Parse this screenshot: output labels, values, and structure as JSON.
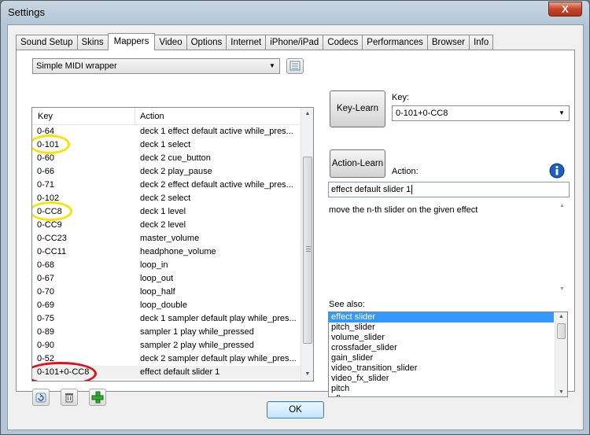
{
  "window": {
    "title": "Settings",
    "close_label": "X"
  },
  "tabs": [
    {
      "label": "Sound Setup"
    },
    {
      "label": "Skins"
    },
    {
      "label": "Mappers",
      "active": true
    },
    {
      "label": "Video"
    },
    {
      "label": "Options"
    },
    {
      "label": "Internet"
    },
    {
      "label": "iPhone/iPad"
    },
    {
      "label": "Codecs"
    },
    {
      "label": "Performances"
    },
    {
      "label": "Browser"
    },
    {
      "label": "Info"
    }
  ],
  "mapper": {
    "selected": "Simple MIDI wrapper"
  },
  "table": {
    "columns": [
      "Key",
      "Action"
    ],
    "rows": [
      {
        "key": "0-64",
        "action": "deck 1 effect  default active while_pres..."
      },
      {
        "key": "0-101",
        "action": "deck 1 select"
      },
      {
        "key": "0-60",
        "action": "deck 2 cue_button"
      },
      {
        "key": "0-66",
        "action": "deck 2 play_pause"
      },
      {
        "key": "0-71",
        "action": "deck 2 effect  default active while_pres..."
      },
      {
        "key": "0-102",
        "action": "deck 2 select"
      },
      {
        "key": "0-CC8",
        "action": "deck 1 level"
      },
      {
        "key": "0-CC9",
        "action": "deck 2 level"
      },
      {
        "key": "0-CC23",
        "action": "master_volume"
      },
      {
        "key": "0-CC11",
        "action": "headphone_volume"
      },
      {
        "key": "0-68",
        "action": "loop_in"
      },
      {
        "key": "0-67",
        "action": "loop_out"
      },
      {
        "key": "0-70",
        "action": "loop_half"
      },
      {
        "key": "0-69",
        "action": "loop_double"
      },
      {
        "key": "0-75",
        "action": "deck 1 sampler  default play while_pres..."
      },
      {
        "key": "0-89",
        "action": "sampler 1 play while_pressed"
      },
      {
        "key": "0-90",
        "action": "sampler 2 play while_pressed"
      },
      {
        "key": "0-52",
        "action": "deck 2 sampler  default play while_pres..."
      },
      {
        "key": "0-101+0-CC8",
        "action": "effect  default slider 1",
        "selected": true
      }
    ]
  },
  "key_panel": {
    "learn_label": "Key-Learn",
    "key_label": "Key:",
    "key_value": "0-101+0-CC8"
  },
  "action_panel": {
    "learn_label": "Action-Learn",
    "action_label": "Action:",
    "action_value": "effect  default slider 1",
    "description": "move the n-th slider on the given effect"
  },
  "see_also": {
    "label": "See also:",
    "items": [
      "effect slider",
      "pitch_slider",
      "volume_slider",
      "crossfader_slider",
      "gain_slider",
      "video_transition_slider",
      "video_fx_slider",
      "pitch",
      "pfl"
    ]
  },
  "ok_label": "OK",
  "colors": {
    "highlight_yellow": "#f5e400",
    "highlight_red": "#e0101a",
    "selection_blue": "#3399ff"
  }
}
